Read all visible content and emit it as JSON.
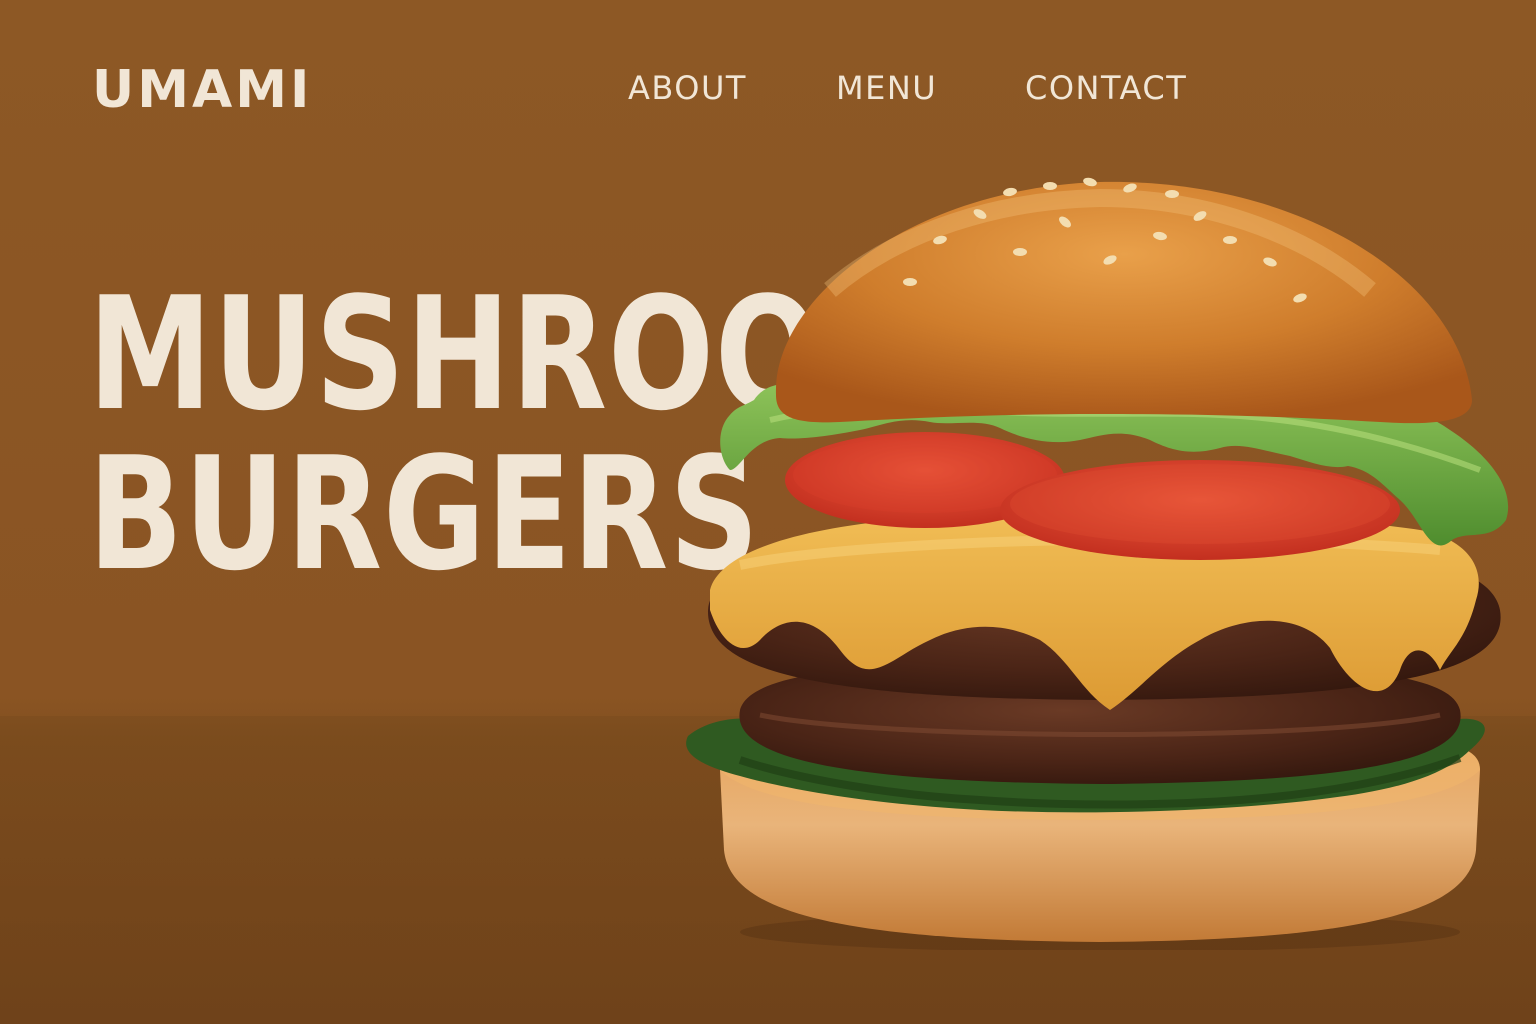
{
  "brand": {
    "name": "UMAMI"
  },
  "nav": {
    "items": [
      {
        "label": "ABOUT"
      },
      {
        "label": "MENU"
      },
      {
        "label": "CONTACT"
      }
    ]
  },
  "hero": {
    "line1": "MUSHROOM",
    "line2": "BURGERS",
    "image": "mushroom-burger-photo"
  },
  "colors": {
    "background": "#8a5423",
    "text": "#f1e6d6"
  }
}
